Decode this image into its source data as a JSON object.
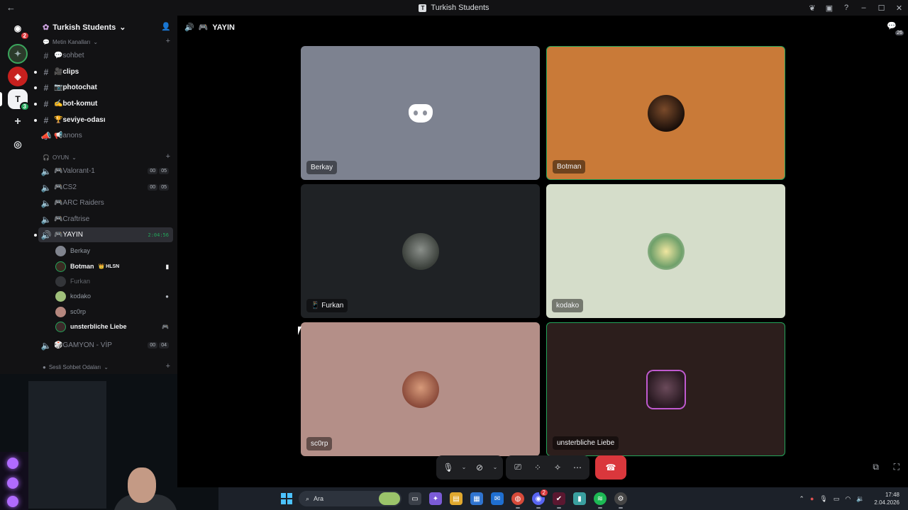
{
  "titlebar": {
    "back_glyph": "←",
    "title": "Turkish Students",
    "server_initial": "T"
  },
  "guilds": {
    "home_badge": "2",
    "server3_initial": "T",
    "server3_badge": "3"
  },
  "server": {
    "name": "Turkish Students"
  },
  "categories": {
    "text": "Metin Kanalları",
    "game": "OYUN",
    "voice_rooms": "Sesli Sohbet Odaları"
  },
  "text_channels": [
    {
      "name": "sohbet",
      "emoji": "💬"
    },
    {
      "name": "clips",
      "emoji": "🎥"
    },
    {
      "name": "photochat",
      "emoji": "📷"
    },
    {
      "name": "bot-komut",
      "emoji": "✍️"
    },
    {
      "name": "seviye-odası",
      "emoji": "🏆"
    },
    {
      "name": "anons",
      "emoji": "📢"
    }
  ],
  "voice_channels": [
    {
      "name": "Valorant-1",
      "emoji": "🎮",
      "count": "00",
      "limit": "05"
    },
    {
      "name": "CS2",
      "emoji": "🎮",
      "count": "00",
      "limit": "05"
    },
    {
      "name": "ARC Raiders",
      "emoji": "🎮"
    },
    {
      "name": "Craftrise",
      "emoji": "🎮"
    },
    {
      "name": "YAYIN",
      "emoji": "🎮",
      "timer": "2:04:56"
    },
    {
      "name": "GAMYON - VİP",
      "emoji": "🎲",
      "count": "00",
      "limit": "04"
    }
  ],
  "voice_users": [
    {
      "name": "Berkay"
    },
    {
      "name": "Botman",
      "tag": "👑 HLSN"
    },
    {
      "name": "Furkan"
    },
    {
      "name": "kodako"
    },
    {
      "name": "sc0rp"
    },
    {
      "name": "unsterbliche Liebe"
    }
  ],
  "call": {
    "channel": "YAYIN",
    "channel_emoji": "🎮",
    "member_count": "26",
    "tiles": [
      {
        "name": "Berkay",
        "bg": "#7d8290",
        "speaking": false
      },
      {
        "name": "Botman",
        "bg": "#c97a38",
        "speaking": true
      },
      {
        "name": "Furkan",
        "bg": "#1f2225",
        "speaking": false,
        "prefix": "📱"
      },
      {
        "name": "kodako",
        "bg": "#d5ddca",
        "speaking": false
      },
      {
        "name": "sc0rp",
        "bg": "#b48f88",
        "speaking": false
      },
      {
        "name": "unsterbliche Liebe",
        "bg": "#2c1e1c",
        "speaking": true
      }
    ]
  },
  "taskbar": {
    "search_label": "Ara",
    "time": "17:48",
    "date": "2.04.2026",
    "discord_badge": "2"
  },
  "colors": {
    "accent_green": "#23a55a",
    "end_call": "#da373c",
    "discord_blurple": "#5865f2"
  }
}
